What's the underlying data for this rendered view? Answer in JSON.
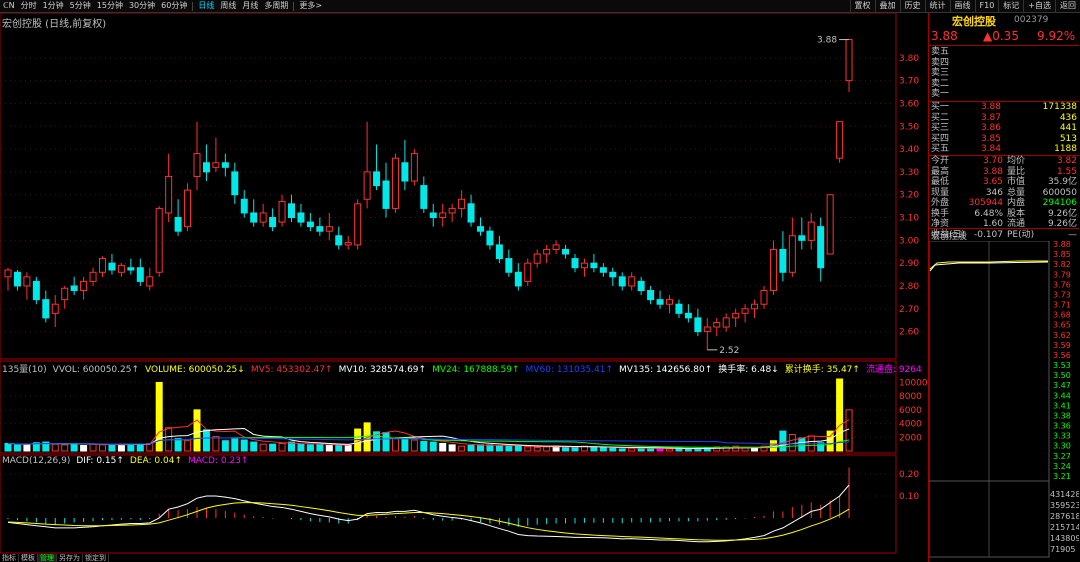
{
  "topbar": {
    "icon": "ℂN",
    "periods": [
      "分时",
      "1分钟",
      "5分钟",
      "15分钟",
      "30分钟",
      "60分钟",
      "日线",
      "周线",
      "月线",
      "多周期",
      "更多>"
    ],
    "active": "日线",
    "right_buttons": [
      "置权",
      "叠加",
      "历史",
      "统计",
      "画线",
      "F10",
      "标记",
      "+自选",
      "返回"
    ]
  },
  "stock": {
    "title": "宏创控股 (日线,前复权)",
    "name": "宏创控股",
    "code": "002379"
  },
  "indicators": {
    "vol_line": [
      {
        "text": "135量(10)",
        "color": "#c0c0c0"
      },
      {
        "text": "VVOL: 600050.25↑",
        "color": "#c0c0c0"
      },
      {
        "text": "VOLUME: 600050.25↓",
        "color": "#ffff00"
      },
      {
        "text": "MV5: 453302.47↑",
        "color": "#ff3030"
      },
      {
        "text": "MV10: 328574.69↑",
        "color": "#ffffff"
      },
      {
        "text": "MV24: 167888.59↑",
        "color": "#00ff00"
      },
      {
        "text": "MV60: 131035.41↑",
        "color": "#2040ff"
      },
      {
        "text": "MV135: 142656.80↑",
        "color": "#ffffff"
      },
      {
        "text": "换手率: 6.48↓",
        "color": "#ffffff"
      },
      {
        "text": "累计换手: 35.47↑",
        "color": "#ffff00"
      },
      {
        "text": "流通盘: 9264",
        "color": "#ff00ff"
      }
    ],
    "macd_line": [
      {
        "text": "MACD(12,26,9)",
        "color": "#c0c0c0"
      },
      {
        "text": "DIF: 0.15↑",
        "color": "#ffffff"
      },
      {
        "text": "DEA: 0.04↑",
        "color": "#ffff00"
      },
      {
        "text": "MACD: 0.23↑",
        "color": "#ff00ff"
      }
    ]
  },
  "bottom_tabs": [
    "指标",
    "模板",
    "管理",
    "另存为",
    "锁定到"
  ],
  "bottom_active": "管理",
  "side": {
    "price": "3.88",
    "change": "▲0.35",
    "pct": "9.92%",
    "asks": [
      {
        "label": "卖五",
        "price": "",
        "vol": ""
      },
      {
        "label": "卖四",
        "price": "",
        "vol": ""
      },
      {
        "label": "卖三",
        "price": "",
        "vol": ""
      },
      {
        "label": "卖二",
        "price": "",
        "vol": ""
      },
      {
        "label": "卖一",
        "price": "",
        "vol": ""
      }
    ],
    "bids": [
      {
        "label": "买一",
        "price": "3.88",
        "vol": "171338"
      },
      {
        "label": "买二",
        "price": "3.87",
        "vol": "436"
      },
      {
        "label": "买三",
        "price": "3.86",
        "vol": "441"
      },
      {
        "label": "买四",
        "price": "3.85",
        "vol": "513"
      },
      {
        "label": "买五",
        "price": "3.84",
        "vol": "1188"
      }
    ],
    "stats": [
      {
        "l1": "今开",
        "v1": "3.70",
        "c1": "#ff3030",
        "l2": "均价",
        "v2": "3.82",
        "c2": "#ff3030"
      },
      {
        "l1": "最高",
        "v1": "3.88",
        "c1": "#ff3030",
        "l2": "量比",
        "v2": "1.55",
        "c2": "#ff3030"
      },
      {
        "l1": "最低",
        "v1": "3.65",
        "c1": "#ff3030",
        "l2": "市值",
        "v2": "35.9亿",
        "c2": "#c0c0c0"
      },
      {
        "l1": "现量",
        "v1": "346",
        "c1": "#c0c0c0",
        "l2": "总量",
        "v2": "600050",
        "c2": "#c0c0c0"
      },
      {
        "l1": "外盘",
        "v1": "305944",
        "c1": "#ff3030",
        "l2": "内盘",
        "v2": "294106",
        "c2": "#00ff00"
      },
      {
        "l1": "换手",
        "v1": "6.48%",
        "c1": "#c0c0c0",
        "l2": "股本",
        "v2": "9.26亿",
        "c2": "#c0c0c0"
      },
      {
        "l1": "净资",
        "v1": "1.60",
        "c1": "#c0c0c0",
        "l2": "流通",
        "v2": "9.26亿",
        "c2": "#c0c0c0"
      },
      {
        "l1": "收益(三)",
        "v1": "-0.107",
        "c1": "#c0c0c0",
        "l2": "PE(动)",
        "v2": "—",
        "c2": "#c0c0c0"
      }
    ],
    "mini_title": "宏创控股",
    "mini_prices": [
      "3.88",
      "3.85",
      "3.82",
      "3.79",
      "3.76",
      "3.73",
      "3.71",
      "3.68",
      "3.65",
      "3.62",
      "3.59",
      "3.56",
      "3.53",
      "3.50",
      "3.47",
      "3.44",
      "3.41",
      "3.38",
      "3.36",
      "3.33",
      "3.30",
      "3.27",
      "3.24",
      "3.21"
    ],
    "mini_vols": [
      "431428",
      "359523",
      "287618",
      "215714",
      "143809",
      "71905"
    ],
    "mini_period": "日线"
  },
  "chart_data": {
    "type": "candlestick",
    "title": "宏创控股 (日线,前复权)",
    "price_axis": [
      "3.80",
      "3.70",
      "3.60",
      "3.50",
      "3.40",
      "3.30",
      "3.20",
      "3.10",
      "3.00",
      "2.90",
      "2.80",
      "2.70",
      "2.60"
    ],
    "ylim": [
      2.55,
      3.9
    ],
    "vol_axis": [
      "10000",
      "8000",
      "6000",
      "4000",
      "2000"
    ],
    "macd_axis": [
      "0.20",
      "0.10"
    ],
    "annotations": {
      "high_label": "3.88",
      "low_label": "2.52"
    },
    "candles": [
      [
        2.84,
        2.88,
        2.78,
        2.87
      ],
      [
        2.86,
        2.87,
        2.78,
        2.8
      ],
      [
        2.8,
        2.86,
        2.74,
        2.84
      ],
      [
        2.82,
        2.84,
        2.72,
        2.74
      ],
      [
        2.74,
        2.78,
        2.64,
        2.66
      ],
      [
        2.68,
        2.76,
        2.62,
        2.72
      ],
      [
        2.74,
        2.8,
        2.7,
        2.79
      ],
      [
        2.8,
        2.84,
        2.76,
        2.78
      ],
      [
        2.78,
        2.84,
        2.74,
        2.82
      ],
      [
        2.82,
        2.88,
        2.8,
        2.86
      ],
      [
        2.86,
        2.93,
        2.84,
        2.92
      ],
      [
        2.9,
        2.94,
        2.85,
        2.87
      ],
      [
        2.86,
        2.9,
        2.84,
        2.89
      ],
      [
        2.88,
        2.92,
        2.85,
        2.87
      ],
      [
        2.88,
        2.92,
        2.8,
        2.82
      ],
      [
        2.8,
        2.88,
        2.78,
        2.84
      ],
      [
        2.86,
        3.15,
        2.84,
        3.14
      ],
      [
        3.12,
        3.38,
        3.08,
        3.28
      ],
      [
        3.1,
        3.18,
        3.02,
        3.04
      ],
      [
        3.06,
        3.25,
        3.04,
        3.22
      ],
      [
        3.28,
        3.52,
        3.22,
        3.38
      ],
      [
        3.34,
        3.42,
        3.26,
        3.3
      ],
      [
        3.32,
        3.45,
        3.3,
        3.34
      ],
      [
        3.34,
        3.38,
        3.28,
        3.32
      ],
      [
        3.3,
        3.34,
        3.16,
        3.2
      ],
      [
        3.18,
        3.22,
        3.1,
        3.12
      ],
      [
        3.12,
        3.18,
        3.06,
        3.08
      ],
      [
        3.08,
        3.16,
        3.06,
        3.12
      ],
      [
        3.1,
        3.14,
        3.04,
        3.06
      ],
      [
        3.08,
        3.2,
        3.06,
        3.17
      ],
      [
        3.16,
        3.2,
        3.08,
        3.1
      ],
      [
        3.12,
        3.16,
        3.06,
        3.08
      ],
      [
        3.08,
        3.12,
        3.04,
        3.06
      ],
      [
        3.06,
        3.1,
        3.02,
        3.04
      ],
      [
        3.04,
        3.12,
        3.0,
        3.06
      ],
      [
        3.02,
        3.06,
        2.96,
        2.98
      ],
      [
        2.98,
        3.02,
        2.96,
        2.99
      ],
      [
        2.98,
        3.18,
        2.96,
        3.16
      ],
      [
        3.18,
        3.52,
        3.14,
        3.3
      ],
      [
        3.3,
        3.42,
        3.22,
        3.24
      ],
      [
        3.26,
        3.34,
        3.1,
        3.14
      ],
      [
        3.14,
        3.38,
        3.12,
        3.36
      ],
      [
        3.34,
        3.44,
        3.22,
        3.26
      ],
      [
        3.26,
        3.4,
        3.24,
        3.38
      ],
      [
        3.24,
        3.28,
        3.12,
        3.14
      ],
      [
        3.12,
        3.16,
        3.06,
        3.1
      ],
      [
        3.1,
        3.16,
        3.06,
        3.12
      ],
      [
        3.12,
        3.16,
        3.08,
        3.14
      ],
      [
        3.14,
        3.22,
        3.1,
        3.18
      ],
      [
        3.16,
        3.2,
        3.06,
        3.08
      ],
      [
        3.06,
        3.1,
        3.02,
        3.04
      ],
      [
        3.04,
        3.06,
        2.96,
        2.98
      ],
      [
        2.98,
        3.02,
        2.9,
        2.92
      ],
      [
        2.92,
        2.96,
        2.84,
        2.86
      ],
      [
        2.86,
        2.9,
        2.78,
        2.8
      ],
      [
        2.82,
        2.92,
        2.8,
        2.9
      ],
      [
        2.9,
        2.96,
        2.88,
        2.94
      ],
      [
        2.94,
        2.98,
        2.9,
        2.96
      ],
      [
        2.96,
        3.0,
        2.94,
        2.98
      ],
      [
        2.96,
        2.98,
        2.92,
        2.94
      ],
      [
        2.92,
        2.94,
        2.86,
        2.88
      ],
      [
        2.88,
        2.92,
        2.84,
        2.9
      ],
      [
        2.9,
        2.94,
        2.86,
        2.88
      ],
      [
        2.88,
        2.9,
        2.84,
        2.86
      ],
      [
        2.86,
        2.88,
        2.8,
        2.84
      ],
      [
        2.84,
        2.86,
        2.78,
        2.8
      ],
      [
        2.8,
        2.86,
        2.78,
        2.84
      ],
      [
        2.82,
        2.84,
        2.76,
        2.78
      ],
      [
        2.78,
        2.8,
        2.72,
        2.74
      ],
      [
        2.74,
        2.78,
        2.7,
        2.72
      ],
      [
        2.72,
        2.76,
        2.68,
        2.74
      ],
      [
        2.72,
        2.74,
        2.66,
        2.68
      ],
      [
        2.68,
        2.72,
        2.64,
        2.66
      ],
      [
        2.66,
        2.7,
        2.58,
        2.6
      ],
      [
        2.6,
        2.66,
        2.52,
        2.62
      ],
      [
        2.62,
        2.66,
        2.58,
        2.64
      ],
      [
        2.62,
        2.68,
        2.6,
        2.66
      ],
      [
        2.66,
        2.7,
        2.62,
        2.68
      ],
      [
        2.68,
        2.72,
        2.64,
        2.7
      ],
      [
        2.7,
        2.74,
        2.66,
        2.72
      ],
      [
        2.72,
        2.8,
        2.7,
        2.78
      ],
      [
        2.78,
        3.0,
        2.76,
        2.96
      ],
      [
        2.96,
        3.04,
        2.82,
        2.86
      ],
      [
        2.86,
        3.1,
        2.84,
        3.02
      ],
      [
        3.02,
        3.1,
        2.96,
        3.0
      ],
      [
        3.0,
        3.12,
        2.96,
        3.08
      ],
      [
        3.06,
        3.1,
        2.82,
        2.88
      ],
      [
        2.94,
        3.2,
        2.94,
        3.2
      ],
      [
        3.36,
        3.52,
        3.34,
        3.52
      ],
      [
        3.7,
        3.88,
        3.65,
        3.88
      ]
    ],
    "volume_colors": [
      "cyan",
      "cyan",
      "white",
      "cyan",
      "cyan",
      "red",
      "red",
      "cyan",
      "white",
      "red",
      "red",
      "cyan",
      "white",
      "cyan",
      "cyan",
      "red",
      "yellow",
      "red",
      "cyan",
      "red",
      "yellow",
      "cyan",
      "red",
      "cyan",
      "cyan",
      "cyan",
      "cyan",
      "red",
      "cyan",
      "red",
      "cyan",
      "cyan",
      "cyan",
      "cyan",
      "white",
      "cyan",
      "white",
      "yellow",
      "yellow",
      "cyan",
      "cyan",
      "red",
      "cyan",
      "red",
      "cyan",
      "cyan",
      "white",
      "white",
      "red",
      "cyan",
      "cyan",
      "cyan",
      "cyan",
      "cyan",
      "cyan",
      "red",
      "red",
      "red",
      "white",
      "cyan",
      "cyan",
      "red",
      "cyan",
      "cyan",
      "cyan",
      "cyan",
      "red",
      "cyan",
      "cyan",
      "magenta",
      "red",
      "cyan",
      "cyan",
      "cyan",
      "cyan",
      "red",
      "red",
      "red",
      "red",
      "white",
      "red",
      "yellow",
      "cyan",
      "red",
      "cyan",
      "red",
      "cyan",
      "yellow",
      "yellow",
      "red"
    ],
    "volumes": [
      1100,
      900,
      1000,
      1200,
      1300,
      1000,
      900,
      1100,
      800,
      1000,
      900,
      1000,
      900,
      900,
      1000,
      1100,
      10000,
      3400,
      1800,
      1500,
      6000,
      3100,
      2100,
      1500,
      1800,
      1600,
      1300,
      1000,
      1000,
      1100,
      1300,
      1000,
      900,
      900,
      800,
      900,
      800,
      3200,
      4100,
      2800,
      2700,
      1800,
      1700,
      1600,
      1400,
      1300,
      1100,
      900,
      700,
      800,
      900,
      900,
      800,
      700,
      700,
      600,
      500,
      600,
      700,
      500,
      600,
      700,
      600,
      500,
      400,
      300,
      400,
      500,
      400,
      300,
      300,
      400,
      300,
      400,
      500,
      600,
      600,
      700,
      500,
      400,
      700,
      1500,
      2900,
      2400,
      1900,
      2200,
      1200,
      2900,
      10500,
      6000
    ],
    "macd": [
      -0.005,
      -0.01,
      -0.015,
      -0.02,
      -0.03,
      -0.03,
      -0.025,
      -0.02,
      -0.018,
      -0.015,
      -0.01,
      -0.01,
      -0.008,
      -0.006,
      -0.01,
      -0.005,
      0.02,
      0.04,
      0.035,
      0.04,
      0.05,
      0.045,
      0.04,
      0.032,
      0.025,
      0.015,
      0.008,
      0.005,
      -0.002,
      0.0,
      -0.005,
      -0.01,
      -0.015,
      -0.018,
      -0.02,
      -0.025,
      -0.025,
      -0.01,
      0.015,
      0.01,
      0.005,
      0.01,
      0.005,
      0.01,
      -0.005,
      -0.01,
      -0.012,
      -0.012,
      -0.008,
      -0.012,
      -0.018,
      -0.025,
      -0.03,
      -0.035,
      -0.04,
      -0.035,
      -0.03,
      -0.028,
      -0.025,
      -0.025,
      -0.025,
      -0.022,
      -0.022,
      -0.022,
      -0.022,
      -0.024,
      -0.02,
      -0.02,
      -0.02,
      -0.018,
      -0.015,
      -0.015,
      -0.015,
      -0.015,
      -0.012,
      -0.01,
      -0.008,
      -0.005,
      -0.002,
      0.005,
      0.01,
      0.03,
      0.03,
      0.05,
      0.06,
      0.07,
      0.06,
      0.08,
      0.1,
      0.23
    ],
    "dif": [
      -0.02,
      -0.025,
      -0.03,
      -0.035,
      -0.04,
      -0.045,
      -0.045,
      -0.045,
      -0.042,
      -0.04,
      -0.035,
      -0.032,
      -0.028,
      -0.025,
      -0.025,
      -0.022,
      0.0,
      0.04,
      0.05,
      0.065,
      0.09,
      0.1,
      0.1,
      0.095,
      0.088,
      0.078,
      0.068,
      0.06,
      0.052,
      0.048,
      0.04,
      0.03,
      0.02,
      0.012,
      0.005,
      -0.005,
      -0.012,
      -0.005,
      0.02,
      0.025,
      0.024,
      0.03,
      0.03,
      0.035,
      0.025,
      0.015,
      0.008,
      0.002,
      -0.002,
      -0.012,
      -0.022,
      -0.035,
      -0.048,
      -0.06,
      -0.075,
      -0.08,
      -0.082,
      -0.083,
      -0.084,
      -0.086,
      -0.088,
      -0.088,
      -0.089,
      -0.09,
      -0.092,
      -0.095,
      -0.094,
      -0.096,
      -0.098,
      -0.1,
      -0.1,
      -0.102,
      -0.105,
      -0.108,
      -0.108,
      -0.106,
      -0.104,
      -0.1,
      -0.095,
      -0.088,
      -0.08,
      -0.06,
      -0.045,
      -0.02,
      0.005,
      0.03,
      0.04,
      0.07,
      0.1,
      0.15
    ],
    "dea": [
      -0.018,
      -0.02,
      -0.022,
      -0.025,
      -0.028,
      -0.03,
      -0.032,
      -0.034,
      -0.035,
      -0.035,
      -0.035,
      -0.034,
      -0.033,
      -0.032,
      -0.03,
      -0.028,
      -0.022,
      -0.01,
      0.002,
      0.015,
      0.03,
      0.045,
      0.055,
      0.062,
      0.068,
      0.07,
      0.07,
      0.068,
      0.065,
      0.062,
      0.058,
      0.052,
      0.046,
      0.04,
      0.033,
      0.025,
      0.018,
      0.012,
      0.012,
      0.015,
      0.017,
      0.02,
      0.022,
      0.025,
      0.025,
      0.023,
      0.02,
      0.016,
      0.012,
      0.007,
      0.001,
      -0.006,
      -0.015,
      -0.024,
      -0.034,
      -0.044,
      -0.052,
      -0.058,
      -0.063,
      -0.068,
      -0.072,
      -0.075,
      -0.078,
      -0.08,
      -0.082,
      -0.084,
      -0.086,
      -0.087,
      -0.089,
      -0.091,
      -0.093,
      -0.095,
      -0.097,
      -0.099,
      -0.1,
      -0.101,
      -0.101,
      -0.1,
      -0.099,
      -0.097,
      -0.094,
      -0.087,
      -0.078,
      -0.066,
      -0.052,
      -0.036,
      -0.022,
      -0.005,
      0.015,
      0.04
    ]
  }
}
